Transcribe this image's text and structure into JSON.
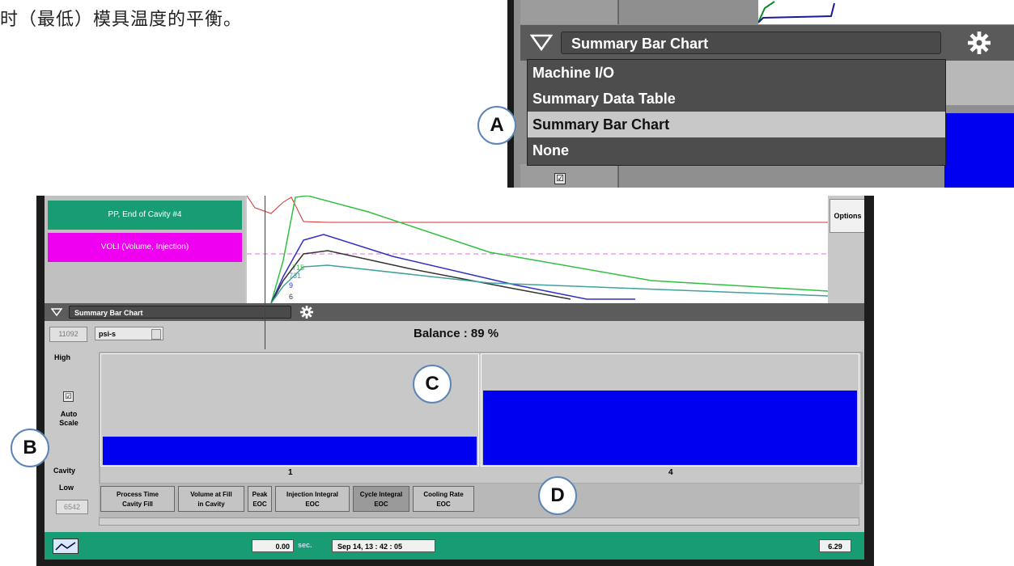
{
  "caption": "时（最低）模具温度的平衡。",
  "inset": {
    "selected_view": "Summary Bar Chart",
    "menu": [
      "Machine I/O",
      "Summary Data Table",
      "Summary Bar Chart",
      "None"
    ],
    "check": "☑"
  },
  "left_labels": {
    "green": "PP, End of Cavity #4",
    "magenta": "VOLI (Volume, Injection)"
  },
  "graph_values": [
    "715",
    "731",
    "9",
    "6"
  ],
  "options_label": "Options",
  "chart_header": {
    "selected_view": "Summary Bar Chart"
  },
  "units": {
    "high_value": "11092",
    "unit": "psi-s",
    "low_value": "6542"
  },
  "balance": {
    "label": "Balance :",
    "value": "89 %"
  },
  "side_labels": {
    "high": "High",
    "auto_scale": "Auto Scale",
    "cavity": "Cavity",
    "low": "Low",
    "check": "☑"
  },
  "chart_data": {
    "type": "bar",
    "categories": [
      "1",
      "4"
    ],
    "values": [
      0.26,
      0.68
    ],
    "xlabel": "Cavity"
  },
  "tabs": [
    {
      "line1": "Process Time",
      "line2": "Cavity Fill",
      "active": false
    },
    {
      "line1": "Volume at Fill",
      "line2": "in Cavity",
      "active": false
    },
    {
      "line1": "Peak",
      "line2": "EOC",
      "active": false
    },
    {
      "line1": "Injection Integral",
      "line2": "EOC",
      "active": false
    },
    {
      "line1": "Cycle Integral",
      "line2": "EOC",
      "active": true
    },
    {
      "line1": "Cooling Rate",
      "line2": "EOC",
      "active": false
    }
  ],
  "status": {
    "value": "0.00",
    "unit": "sec.",
    "timestamp": "Sep 14, 13 : 42 : 05",
    "right_value": "6.29"
  },
  "callouts": {
    "a": "A",
    "b": "B",
    "c": "C",
    "d": "D"
  },
  "colors": {
    "bar": "#0000f0",
    "status_green": "#189c74",
    "magenta": "#f000f0"
  }
}
